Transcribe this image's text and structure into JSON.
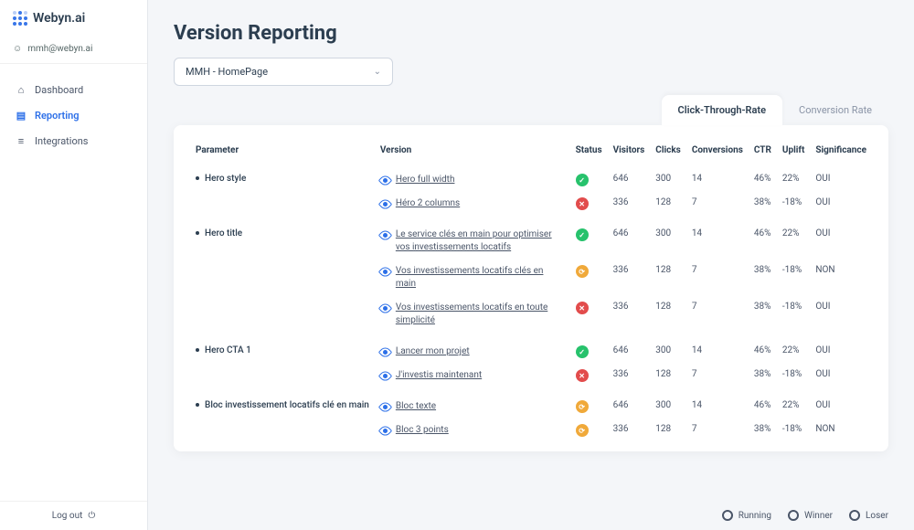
{
  "brand": "Webyn.ai",
  "user_email": "mmh@webyn.ai",
  "sidebar": {
    "items": [
      {
        "label": "Dashboard",
        "icon": "home-icon"
      },
      {
        "label": "Reporting",
        "icon": "report-icon",
        "active": true
      },
      {
        "label": "Integrations",
        "icon": "layers-icon"
      }
    ],
    "logout_label": "Log out"
  },
  "page": {
    "title": "Version Reporting",
    "select_value": "MMH - HomePage"
  },
  "tabs": [
    {
      "label": "Click-Through-Rate",
      "active": true
    },
    {
      "label": "Conversion Rate"
    }
  ],
  "table": {
    "columns": [
      "Parameter",
      "Version",
      "Status",
      "Visitors",
      "Clicks",
      "Conversions",
      "CTR",
      "Uplift",
      "Significance"
    ],
    "groups": [
      {
        "parameter": "Hero style",
        "rows": [
          {
            "version": "Hero full width",
            "status": "winner",
            "visitors": "646",
            "clicks": "300",
            "conversions": "14",
            "ctr": "46%",
            "uplift": "22%",
            "significance": "OUI"
          },
          {
            "version": "Héro 2 columns",
            "status": "loser",
            "visitors": "336",
            "clicks": "128",
            "conversions": "7",
            "ctr": "38%",
            "uplift": "-18%",
            "significance": "OUI"
          }
        ]
      },
      {
        "parameter": "Hero title",
        "rows": [
          {
            "version": "Le service clés en main pour optimiser vos investissements locatifs",
            "status": "winner",
            "visitors": "646",
            "clicks": "300",
            "conversions": "14",
            "ctr": "46%",
            "uplift": "22%",
            "significance": "OUI"
          },
          {
            "version": "Vos investissements locatifs clés en main",
            "status": "running",
            "visitors": "336",
            "clicks": "128",
            "conversions": "7",
            "ctr": "38%",
            "uplift": "-18%",
            "significance": "NON"
          },
          {
            "version": "Vos investissements locatifs en toute simplicité",
            "status": "loser",
            "visitors": "336",
            "clicks": "128",
            "conversions": "7",
            "ctr": "38%",
            "uplift": "-18%",
            "significance": "OUI"
          }
        ]
      },
      {
        "parameter": "Hero CTA 1",
        "rows": [
          {
            "version": "Lancer mon projet",
            "status": "winner",
            "visitors": "646",
            "clicks": "300",
            "conversions": "14",
            "ctr": "46%",
            "uplift": "22%",
            "significance": "OUI"
          },
          {
            "version": "J'investis maintenant",
            "status": "loser",
            "visitors": "336",
            "clicks": "128",
            "conversions": "7",
            "ctr": "38%",
            "uplift": "-18%",
            "significance": "OUI"
          }
        ]
      },
      {
        "parameter": "Bloc investissement locatifs clé en main",
        "rows": [
          {
            "version": "Bloc texte",
            "status": "running",
            "visitors": "646",
            "clicks": "300",
            "conversions": "14",
            "ctr": "46%",
            "uplift": "22%",
            "significance": "OUI"
          },
          {
            "version": "Bloc 3 points",
            "status": "running",
            "visitors": "336",
            "clicks": "128",
            "conversions": "7",
            "ctr": "38%",
            "uplift": "-18%",
            "significance": "NON"
          }
        ]
      }
    ]
  },
  "legend": {
    "running": "Running",
    "winner": "Winner",
    "loser": "Loser"
  },
  "status_glyph": {
    "winner": "✓",
    "loser": "✕",
    "running": "⟳"
  }
}
